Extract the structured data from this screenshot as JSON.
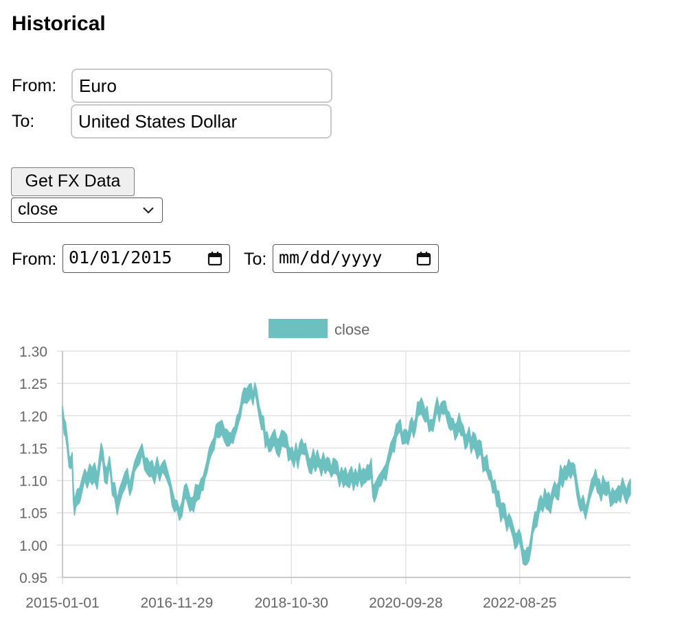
{
  "page": {
    "title": "Historical",
    "from_label": "From:",
    "to_label": "To:",
    "from_currency": "Euro",
    "to_currency": "United States Dollar",
    "button_label": "Get FX Data",
    "metric_select": "close",
    "date_from_label": "From:",
    "date_from_value": "01/01/2015",
    "date_to_label": "To:",
    "date_to_placeholder": "mm/dd/yyyy"
  },
  "chart_data": {
    "type": "area",
    "legend": {
      "position": "top",
      "label": "close"
    },
    "colors": {
      "series": "#6cc0c0",
      "grid": "#e1e1e1",
      "axis": "#666666"
    },
    "ylim": [
      0.95,
      1.3
    ],
    "y_ticks": [
      "1.30",
      "1.25",
      "1.20",
      "1.15",
      "1.10",
      "1.05",
      "1.00",
      "0.95"
    ],
    "x_ticks": [
      "2015-01-01",
      "2016-11-29",
      "2018-10-30",
      "2020-09-28",
      "2022-08-25"
    ],
    "x_range": [
      "2015-01-01",
      "2024-07-01"
    ],
    "series": [
      {
        "name": "close",
        "points": [
          [
            "2015-01-01",
            1.205
          ],
          [
            "2015-01-20",
            1.17
          ],
          [
            "2015-02-10",
            1.13
          ],
          [
            "2015-03-01",
            1.12
          ],
          [
            "2015-03-15",
            1.06
          ],
          [
            "2015-04-01",
            1.07
          ],
          [
            "2015-05-01",
            1.1
          ],
          [
            "2015-06-01",
            1.1
          ],
          [
            "2015-07-01",
            1.11
          ],
          [
            "2015-08-01",
            1.1
          ],
          [
            "2015-08-25",
            1.14
          ],
          [
            "2015-09-15",
            1.12
          ],
          [
            "2015-10-15",
            1.12
          ],
          [
            "2015-11-01",
            1.1
          ],
          [
            "2015-12-01",
            1.06
          ],
          [
            "2016-01-01",
            1.09
          ],
          [
            "2016-02-01",
            1.1
          ],
          [
            "2016-03-01",
            1.1
          ],
          [
            "2016-04-01",
            1.13
          ],
          [
            "2016-05-01",
            1.14
          ],
          [
            "2016-06-01",
            1.12
          ],
          [
            "2016-07-01",
            1.11
          ],
          [
            "2016-08-01",
            1.12
          ],
          [
            "2016-09-01",
            1.12
          ],
          [
            "2016-10-01",
            1.11
          ],
          [
            "2016-11-01",
            1.08
          ],
          [
            "2016-12-15",
            1.04
          ],
          [
            "2017-01-15",
            1.07
          ],
          [
            "2017-03-01",
            1.07
          ],
          [
            "2017-04-15",
            1.08
          ],
          [
            "2017-06-01",
            1.12
          ],
          [
            "2017-07-15",
            1.16
          ],
          [
            "2017-09-01",
            1.19
          ],
          [
            "2017-10-15",
            1.17
          ],
          [
            "2017-12-01",
            1.18
          ],
          [
            "2018-01-15",
            1.23
          ],
          [
            "2018-02-15",
            1.24
          ],
          [
            "2018-04-01",
            1.23
          ],
          [
            "2018-05-01",
            1.19
          ],
          [
            "2018-06-15",
            1.16
          ],
          [
            "2018-08-01",
            1.16
          ],
          [
            "2018-09-01",
            1.16
          ],
          [
            "2018-10-01",
            1.15
          ],
          [
            "2018-11-15",
            1.14
          ],
          [
            "2019-01-01",
            1.14
          ],
          [
            "2019-03-01",
            1.13
          ],
          [
            "2019-05-01",
            1.12
          ],
          [
            "2019-07-01",
            1.12
          ],
          [
            "2019-09-01",
            1.1
          ],
          [
            "2019-11-01",
            1.1
          ],
          [
            "2020-01-01",
            1.11
          ],
          [
            "2020-03-01",
            1.11
          ],
          [
            "2020-03-20",
            1.07
          ],
          [
            "2020-04-15",
            1.09
          ],
          [
            "2020-05-15",
            1.1
          ],
          [
            "2020-06-15",
            1.13
          ],
          [
            "2020-08-01",
            1.18
          ],
          [
            "2020-10-01",
            1.17
          ],
          [
            "2020-11-15",
            1.19
          ],
          [
            "2021-01-01",
            1.22
          ],
          [
            "2021-03-01",
            1.19
          ],
          [
            "2021-05-15",
            1.22
          ],
          [
            "2021-07-01",
            1.19
          ],
          [
            "2021-09-01",
            1.18
          ],
          [
            "2021-11-01",
            1.16
          ],
          [
            "2022-01-01",
            1.14
          ],
          [
            "2022-03-01",
            1.1
          ],
          [
            "2022-05-01",
            1.06
          ],
          [
            "2022-07-15",
            1.02
          ],
          [
            "2022-09-01",
            1.0
          ],
          [
            "2022-09-28",
            0.97
          ],
          [
            "2022-11-01",
            1.0
          ],
          [
            "2023-01-01",
            1.07
          ],
          [
            "2023-03-01",
            1.06
          ],
          [
            "2023-05-01",
            1.1
          ],
          [
            "2023-07-15",
            1.12
          ],
          [
            "2023-09-01",
            1.07
          ],
          [
            "2023-10-01",
            1.06
          ],
          [
            "2023-12-01",
            1.1
          ],
          [
            "2024-01-15",
            1.09
          ],
          [
            "2024-03-01",
            1.08
          ],
          [
            "2024-05-01",
            1.08
          ],
          [
            "2024-07-01",
            1.09
          ]
        ]
      }
    ]
  }
}
